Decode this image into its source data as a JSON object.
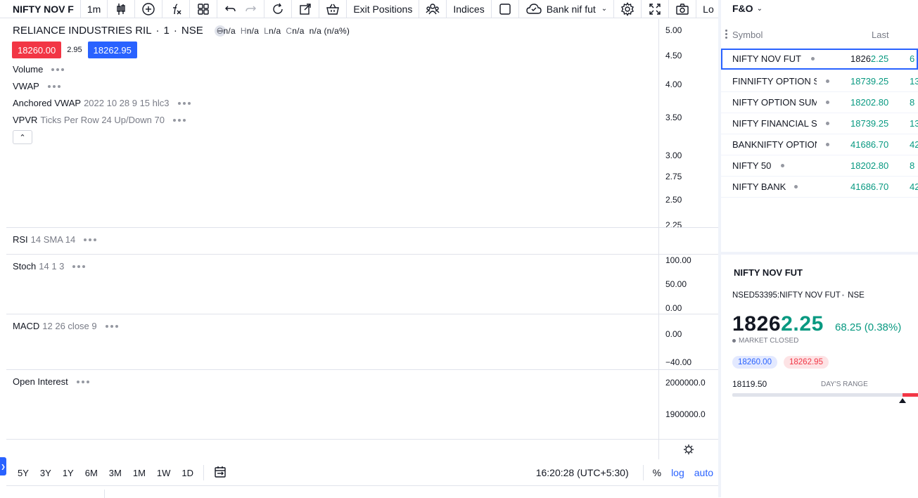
{
  "toolbar": {
    "symbol": "NIFTY NOV F",
    "interval": "1m",
    "exit_positions": "Exit Positions",
    "indices": "Indices",
    "watch_name": "Bank nif fut",
    "login": "Lo"
  },
  "legend": {
    "name": "RELIANCE INDUSTRIES RIL",
    "interval": "1",
    "exchange": "NSE",
    "ohlc": {
      "o_key": "O",
      "o": "n/a",
      "h_key": "H",
      "h": "n/a",
      "l_key": "L",
      "l": "n/a",
      "c_key": "C",
      "c": "n/a",
      "change": "n/a (n/a%)"
    },
    "sell_price": "18260.00",
    "spread": "2.95",
    "buy_price": "18262.95"
  },
  "indicators": {
    "volume": {
      "name": "Volume",
      "params": ""
    },
    "vwap": {
      "name": "VWAP",
      "params": ""
    },
    "avwap": {
      "name": "Anchored VWAP",
      "params": "2022 10 28 9 15 hlc3"
    },
    "vpvr": {
      "name": "VPVR",
      "params": "Ticks Per Row 24 Up/Down 70"
    },
    "rsi": {
      "name": "RSI",
      "params": "14 SMA 14"
    },
    "stoch": {
      "name": "Stoch",
      "params": "14 1 3"
    },
    "macd": {
      "name": "MACD",
      "params": "12 26 close 9"
    },
    "oi": {
      "name": "Open Interest",
      "params": ""
    }
  },
  "axes": {
    "main": [
      "5.00",
      "4.50",
      "4.00",
      "3.50",
      "3.00",
      "2.75",
      "2.50",
      "2.25"
    ],
    "stoch": [
      "100.00",
      "50.00",
      "0.00"
    ],
    "macd": [
      "0.00",
      "−40.00"
    ],
    "oi": [
      "2000000.0",
      "1900000.0"
    ]
  },
  "bottombar": {
    "timeframes": [
      "5Y",
      "3Y",
      "1Y",
      "6M",
      "3M",
      "1M",
      "1W",
      "1D"
    ],
    "time": "16:20:28 (UTC+5:30)",
    "percent": "%",
    "log": "log",
    "auto": "auto"
  },
  "watchlist": {
    "title": "F&O",
    "col_symbol": "Symbol",
    "col_last": "Last",
    "rows": [
      {
        "name": "NIFTY NOV FUT",
        "last_prefix": "1826",
        "last_suffix": "2.25",
        "chg": "6"
      },
      {
        "name": "FINNIFTY OPTION S",
        "last_prefix": "",
        "last_suffix": "18739.25",
        "chg": "13"
      },
      {
        "name": "NIFTY OPTION SUMM",
        "last_prefix": "",
        "last_suffix": "18202.80",
        "chg": "8"
      },
      {
        "name": "NIFTY FINANCIAL SE",
        "last_prefix": "",
        "last_suffix": "18739.25",
        "chg": "13"
      },
      {
        "name": "BANKNIFTY OPTION",
        "last_prefix": "",
        "last_suffix": "41686.70",
        "chg": "42"
      },
      {
        "name": "NIFTY 50",
        "last_prefix": "",
        "last_suffix": "18202.80",
        "chg": "8"
      },
      {
        "name": "NIFTY BANK",
        "last_prefix": "",
        "last_suffix": "41686.70",
        "chg": "42"
      }
    ]
  },
  "details": {
    "title": "NIFTY NOV FUT",
    "symbol_full": "NSED53395:NIFTY NOV FUT",
    "exchange": "NSE",
    "price_main": "1826",
    "price_tail": "2.25",
    "change": "68.25 (0.38%)",
    "status": "MARKET CLOSED",
    "bid": "18260.00",
    "ask": "18262.95",
    "low": "18119.50",
    "range_label": "DAY'S RANGE",
    "range_position": 0.97
  },
  "colors": {
    "up": "#089981",
    "down": "#f23645",
    "accent": "#2962ff"
  }
}
